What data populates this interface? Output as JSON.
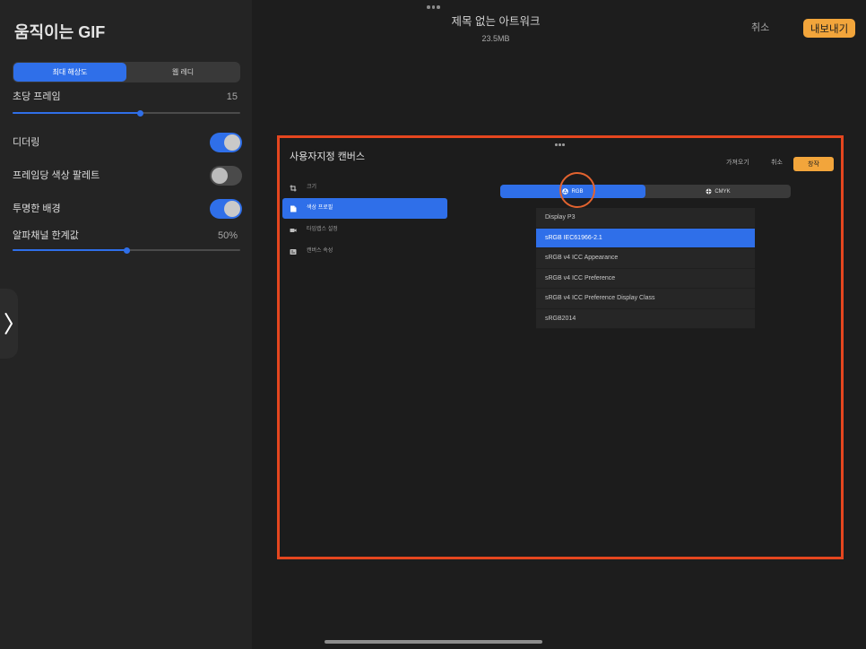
{
  "colors": {
    "accent": "#2f6fe9",
    "export_orange": "#f2a53b",
    "highlight_border": "#e5461f",
    "highlight_circle": "#e2632f"
  },
  "export_panel": {
    "title": "움직이는 GIF",
    "resolution_options": [
      {
        "label": "최대 해상도",
        "selected": true
      },
      {
        "label": "웹 레디",
        "selected": false
      }
    ],
    "frames_per_second": {
      "label": "초당 프레임",
      "value": "15",
      "slider_fraction": 0.56
    },
    "toggles": [
      {
        "label": "디더링",
        "on": true
      },
      {
        "label": "프레임당 색상 팔레트",
        "on": false
      },
      {
        "label": "투명한 배경",
        "on": true
      }
    ],
    "alpha_threshold": {
      "label": "알파채널 한계값",
      "value": "50%",
      "slider_fraction": 0.5
    }
  },
  "side_tab": {
    "icon": "chevron-right-icon"
  },
  "header": {
    "artwork_title": "제목 없는 아트워크",
    "file_size": "23.5MB",
    "cancel_label": "취소",
    "export_label": "내보내기"
  },
  "preview": {
    "dialog_title": "사용자지정 캔버스",
    "import_label": "가져오기",
    "cancel_label": "취소",
    "create_label": "창작",
    "sidebar_items": [
      {
        "label": "크기",
        "icon": "crop-icon",
        "selected": false
      },
      {
        "label": "색상 프로필",
        "icon": "color-profile-icon",
        "selected": true
      },
      {
        "label": "타임랩스 설정",
        "icon": "video-camera-icon",
        "selected": false
      },
      {
        "label": "캔버스 속성",
        "icon": "canvas-properties-icon",
        "selected": false
      }
    ],
    "color_mode_tabs": [
      {
        "label": "RGB",
        "icon": "color-wheel-icon",
        "selected": true
      },
      {
        "label": "CMYK",
        "icon": "crosshair-icon",
        "selected": false
      }
    ],
    "color_profiles": [
      {
        "label": "Display P3",
        "selected": false
      },
      {
        "label": "sRGB IEC61966-2.1",
        "selected": true
      },
      {
        "label": "sRGB v4 ICC Appearance",
        "selected": false
      },
      {
        "label": "sRGB v4 ICC Preference",
        "selected": false
      },
      {
        "label": "sRGB v4 ICC Preference Display Class",
        "selected": false
      },
      {
        "label": "sRGB2014",
        "selected": false
      }
    ]
  }
}
